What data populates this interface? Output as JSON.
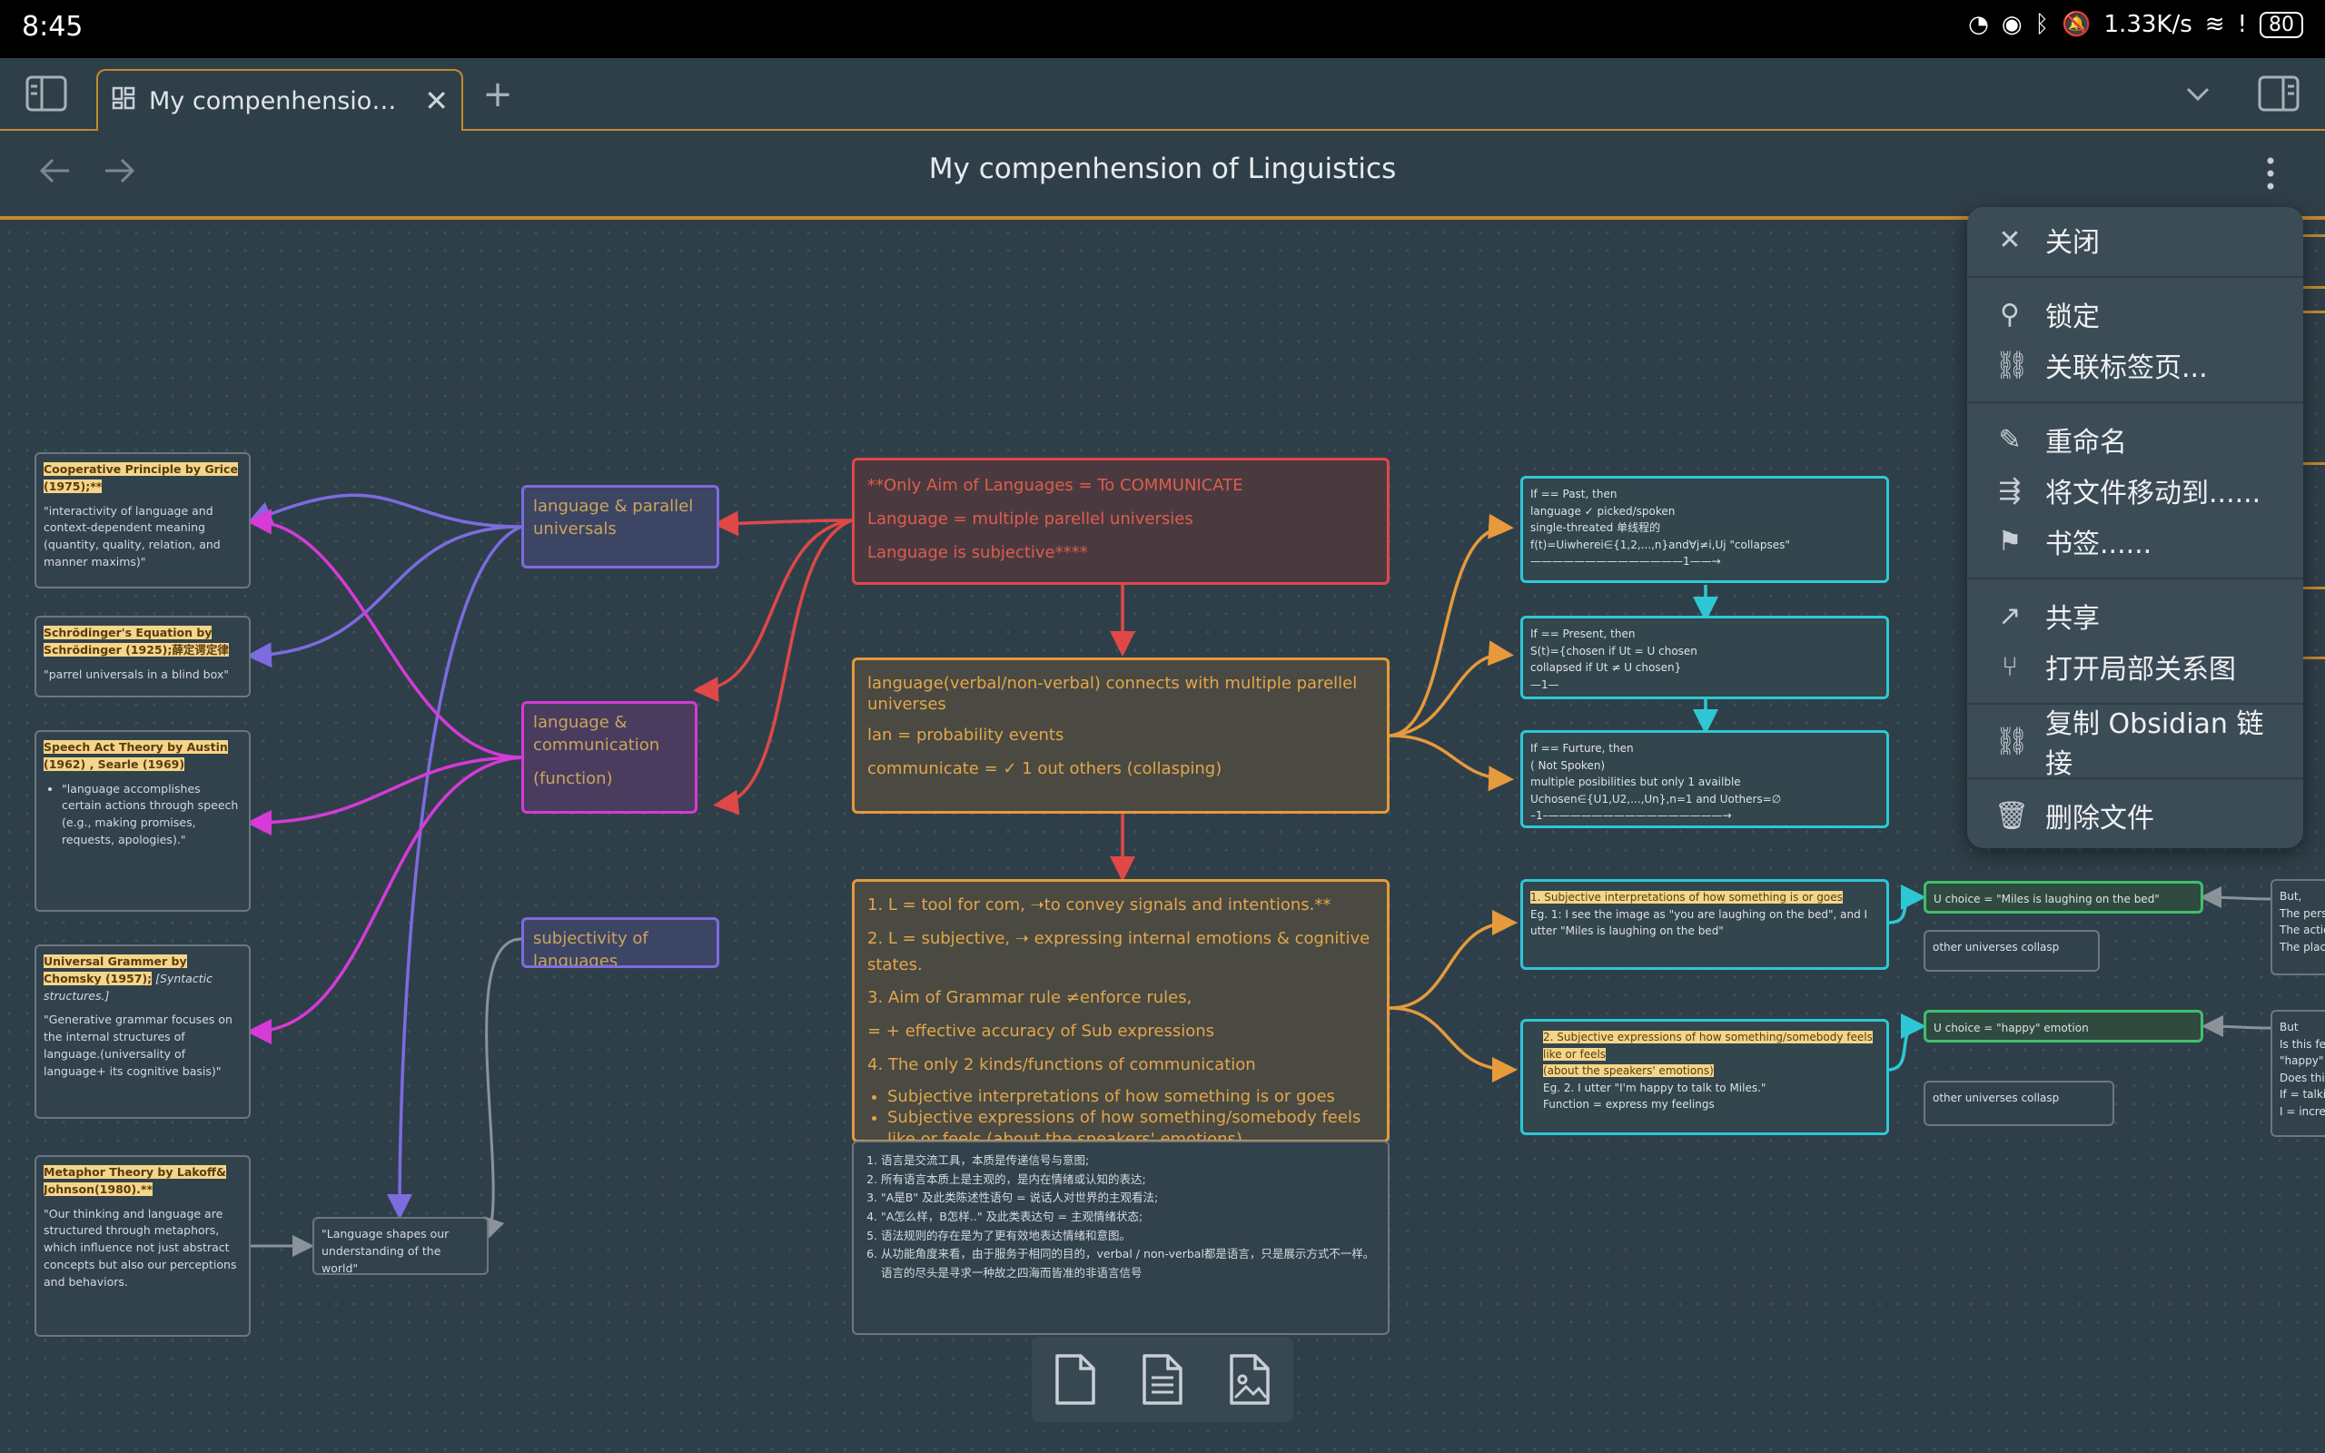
{
  "status_bar": {
    "time": "8:45",
    "speed": "1.33K/s",
    "battery": "80"
  },
  "tab": {
    "title": "My compenhension o...",
    "add": "+"
  },
  "header": {
    "title": "My compenhension of Linguistics"
  },
  "left_cards": [
    {
      "title": "Cooperative Principle by Grice (1975);**",
      "body": "\"interactivity of language and context-dependent meaning (quantity, quality, relation,  and manner maxims)\""
    },
    {
      "title": "Schrödinger's Equation by Schrödinger (1925);薛定谔定律",
      "body": "\"parrel universals in a blind box\""
    },
    {
      "title": "Speech Act Theory by Austin (1962) , Searle (1969)",
      "body": "\"language accomplishes certain actions through speech (e.g., making promises, requests, apologies).\""
    },
    {
      "title": "Universal Grammer by Chomsky (1957);",
      "tail": "[Syntactic structures.]",
      "body": "\"Generative grammar focuses on the internal structures of language.(universality of language+ its cognitive basis)\""
    },
    {
      "title": "Metaphor Theory by Lakoff& Johnson(1980).**",
      "body": "\"Our thinking and language are structured through metaphors, which influence not just abstract concepts but also our perceptions and behaviors."
    }
  ],
  "quote_card": "\"Language shapes our understanding of the world\"",
  "mid_nodes": {
    "parallel": "language & parallel universals",
    "communication": [
      "language &",
      "communication",
      "(function)"
    ],
    "subjectivity": "subjectivity of languages"
  },
  "top_box": [
    "**Only Aim of Languages = To COMMUNICATE",
    "Language = multiple parellel universies",
    "Language is subjective****"
  ],
  "middle_box": [
    "language(verbal/non-verbal) connects with multiple parellel universes",
    "lan = probability events",
    "communicate = ✓ 1 out others (collasping)"
  ],
  "bottom_box": {
    "lines": [
      "1. L = tool for com, ➝to convey signals and intentions.**",
      "2. L = subjective, ➝ expressing internal emotions & cognitive states.",
      "3. Aim of Grammar rule ≠enforce rules,",
      "= + effective accuracy of Sub expressions",
      "4. The only 2 kinds/functions of communication"
    ],
    "bullets": [
      "Subjective interpretations of how something is or goes",
      "Subjective expressions of how something/somebody feels like or feels (about the speakers' emotions)"
    ]
  },
  "chinese_box": [
    "语言是交流工具，本质是传递信号与意图;",
    "所有语言本质上是主观的，是内在情绪或认知的表达;",
    "\"A是B\" 及此类陈述性语句 = 说话人对世界的主观看法;",
    "\"A怎么样，B怎样..\" 及此类表达句 = 主观情绪状态;",
    "语法规则的存在是为了更有效地表达情绪和意图。",
    "从功能角度来看，由于服务于相同的目的，verbal / non-verbal都是语言，只是展示方式不一样。语言的尽头是寻求一种故之四海而皆准的非语言信号"
  ],
  "right_boxes": {
    "past": [
      "If == Past, then",
      "language ✓ picked/spoken",
      "single-threated 单线程的",
      "f(t)=Uiwherei∈{1,2,...,n}and∀j≠i,Uj \"collapses\"",
      "——————————————1——→"
    ],
    "present": [
      "If == Present, then",
      "S(t)={chosen if Ut = U chosen",
      "collapsed if Ut ≠ U chosen}",
      "—1—"
    ],
    "future": [
      "If == Furture, then",
      "( Not Spoken)",
      "multiple posibilities but only 1 availble",
      "Uchosen∈{U1,U2,...,Un},n=1 and Uothers=∅",
      "–1–————————————————→"
    ],
    "interp": {
      "title": "1. Subjective interpretations of how something is or goes",
      "body": [
        "Eg. 1: I see the image as \"you are laughing on the bed\", and I utter \"Miles is laughing on the bed\""
      ]
    },
    "expr": {
      "title": "2. Subjective expressions of how something/somebody feels like or feels",
      "title2": "(about the speakers' emotions)",
      "body": [
        "Eg. 2. I utter \"I'm happy to talk to Miles.\"",
        "Function = express my feelings"
      ]
    },
    "choice1": "U choice = \"Miles is laughing on the bed\"",
    "collapse1": "other universes collasp",
    "choice2": "U choice = \"happy\" emotion",
    "collapse2": "other universes collasp",
    "far1": [
      "But,",
      "The perso",
      "The actio",
      "The place"
    ],
    "far2": [
      "But",
      "Is this fee",
      "\"happy\"",
      "Does this",
      "If = talkin",
      "I = increa"
    ]
  },
  "menu": {
    "groups": [
      [
        {
          "icon": "close-icon",
          "label": "关闭"
        }
      ],
      [
        {
          "icon": "pin-icon",
          "label": "锁定"
        },
        {
          "icon": "link-icon",
          "label": "关联标签页..."
        }
      ],
      [
        {
          "icon": "pencil-icon",
          "label": "重命名"
        },
        {
          "icon": "move-icon",
          "label": "将文件移动到......"
        },
        {
          "icon": "bookmark-icon",
          "label": "书签......"
        }
      ],
      [
        {
          "icon": "share-arrow-icon",
          "label": "共享"
        },
        {
          "icon": "graph-icon",
          "label": "打开局部关系图"
        }
      ],
      [
        {
          "icon": "link-icon",
          "label": "复制 Obsidian 链接"
        }
      ],
      [
        {
          "icon": "trash-icon",
          "label": "删除文件"
        }
      ]
    ]
  },
  "colors": {
    "accent": "#c4882f",
    "red": "#e04848",
    "orange": "#e69a3c",
    "teal": "#2ec8d4",
    "green": "#3fbf6e",
    "purple": "#7d6be0",
    "magenta": "#d63ad8",
    "gray": "#8a939a"
  }
}
